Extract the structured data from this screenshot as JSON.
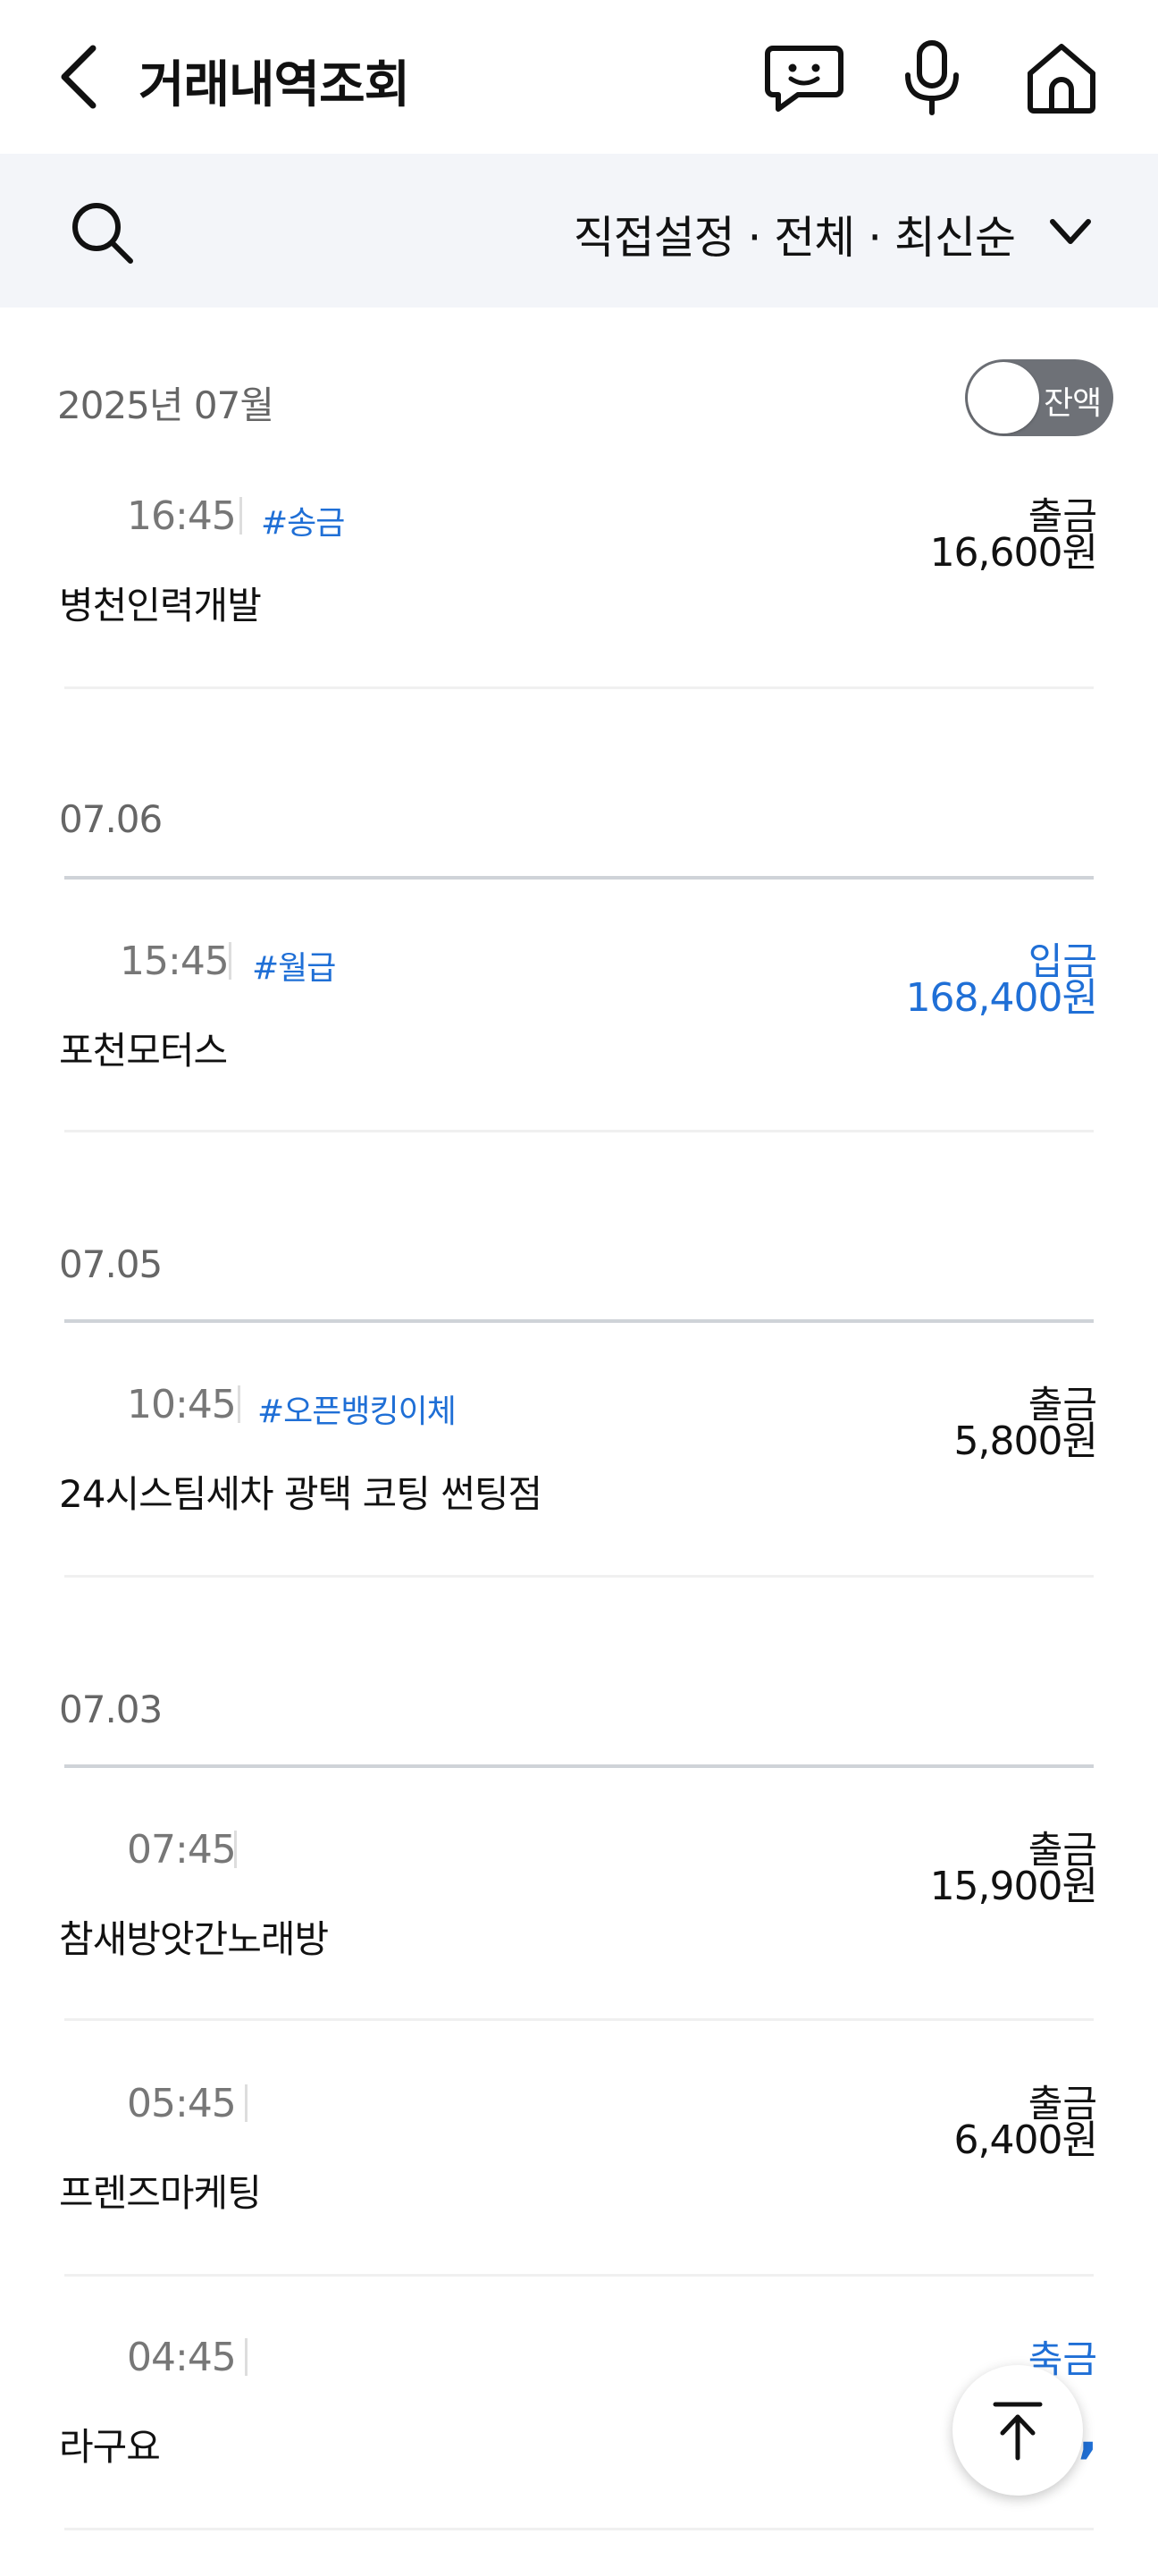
{
  "header": {
    "title": "거래내역조회",
    "icons": [
      "back-icon",
      "chatbot-icon",
      "microphone-icon",
      "home-icon"
    ]
  },
  "filter": {
    "summary": "직접설정 · 전체 · 최신순",
    "icons": [
      "search-icon",
      "chevron-down-icon"
    ]
  },
  "month": "2025년 07월",
  "balance_toggle": {
    "label": "잔액",
    "on": false
  },
  "transactions": [
    {
      "time": "16:45",
      "tag": "#송금",
      "description": "병천인력개발",
      "type": "출금",
      "amount": "16,600원"
    },
    {
      "date": "07.06",
      "time": "15:45",
      "tag": "#월급",
      "description": "포천모터스",
      "type": "입금",
      "amount": "168,400원"
    },
    {
      "date": "07.05",
      "time": "10:45",
      "tag": "#오픈뱅킹이체",
      "description": "24시스팀세차 광택 코팅 썬팅점",
      "type": "출금",
      "amount": "5,800원"
    },
    {
      "date": "07.03",
      "time": "07:45",
      "tag": "",
      "description": "참새방앗간노래방",
      "type": "출금",
      "amount": "15,900원"
    },
    {
      "time": "05:45",
      "tag": "",
      "description": "프렌즈마케팅",
      "type": "출금",
      "amount": "6,400원"
    },
    {
      "time": "04:45",
      "tag": "",
      "description": "라구요",
      "type": "축금",
      "amount": "12,"
    }
  ],
  "colors": {
    "accent": "#1f6fd6",
    "filter_bg": "#f3f5f9",
    "toggle_bg": "#6e7177"
  },
  "scroll_top_icon": "arrow-up-icon"
}
